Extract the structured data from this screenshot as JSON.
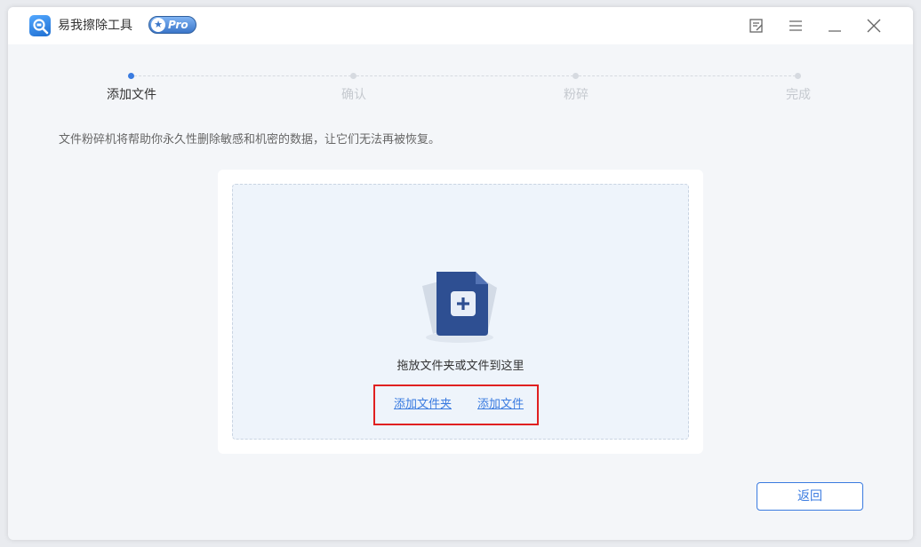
{
  "app": {
    "title": "易我擦除工具",
    "badge": "Pro",
    "logo_icon": "magnifier-eraser-icon"
  },
  "titlebar": {
    "icons": [
      "feedback-icon",
      "menu-icon",
      "minimize-icon",
      "close-icon"
    ]
  },
  "steps": [
    {
      "label": "添加文件",
      "active": true
    },
    {
      "label": "确认",
      "active": false
    },
    {
      "label": "粉碎",
      "active": false
    },
    {
      "label": "完成",
      "active": false
    }
  ],
  "description": "文件粉碎机将帮助你永久性删除敏感和机密的数据，让它们无法再被恢复。",
  "dropzone": {
    "hint": "拖放文件夹或文件到这里",
    "add_folder_link": "添加文件夹",
    "add_file_link": "添加文件",
    "illustration_icon": "add-file-icon"
  },
  "footer": {
    "back_label": "返回"
  },
  "colors": {
    "accent": "#3a7be0",
    "highlight": "#e02020",
    "background": "#f4f6f9"
  }
}
